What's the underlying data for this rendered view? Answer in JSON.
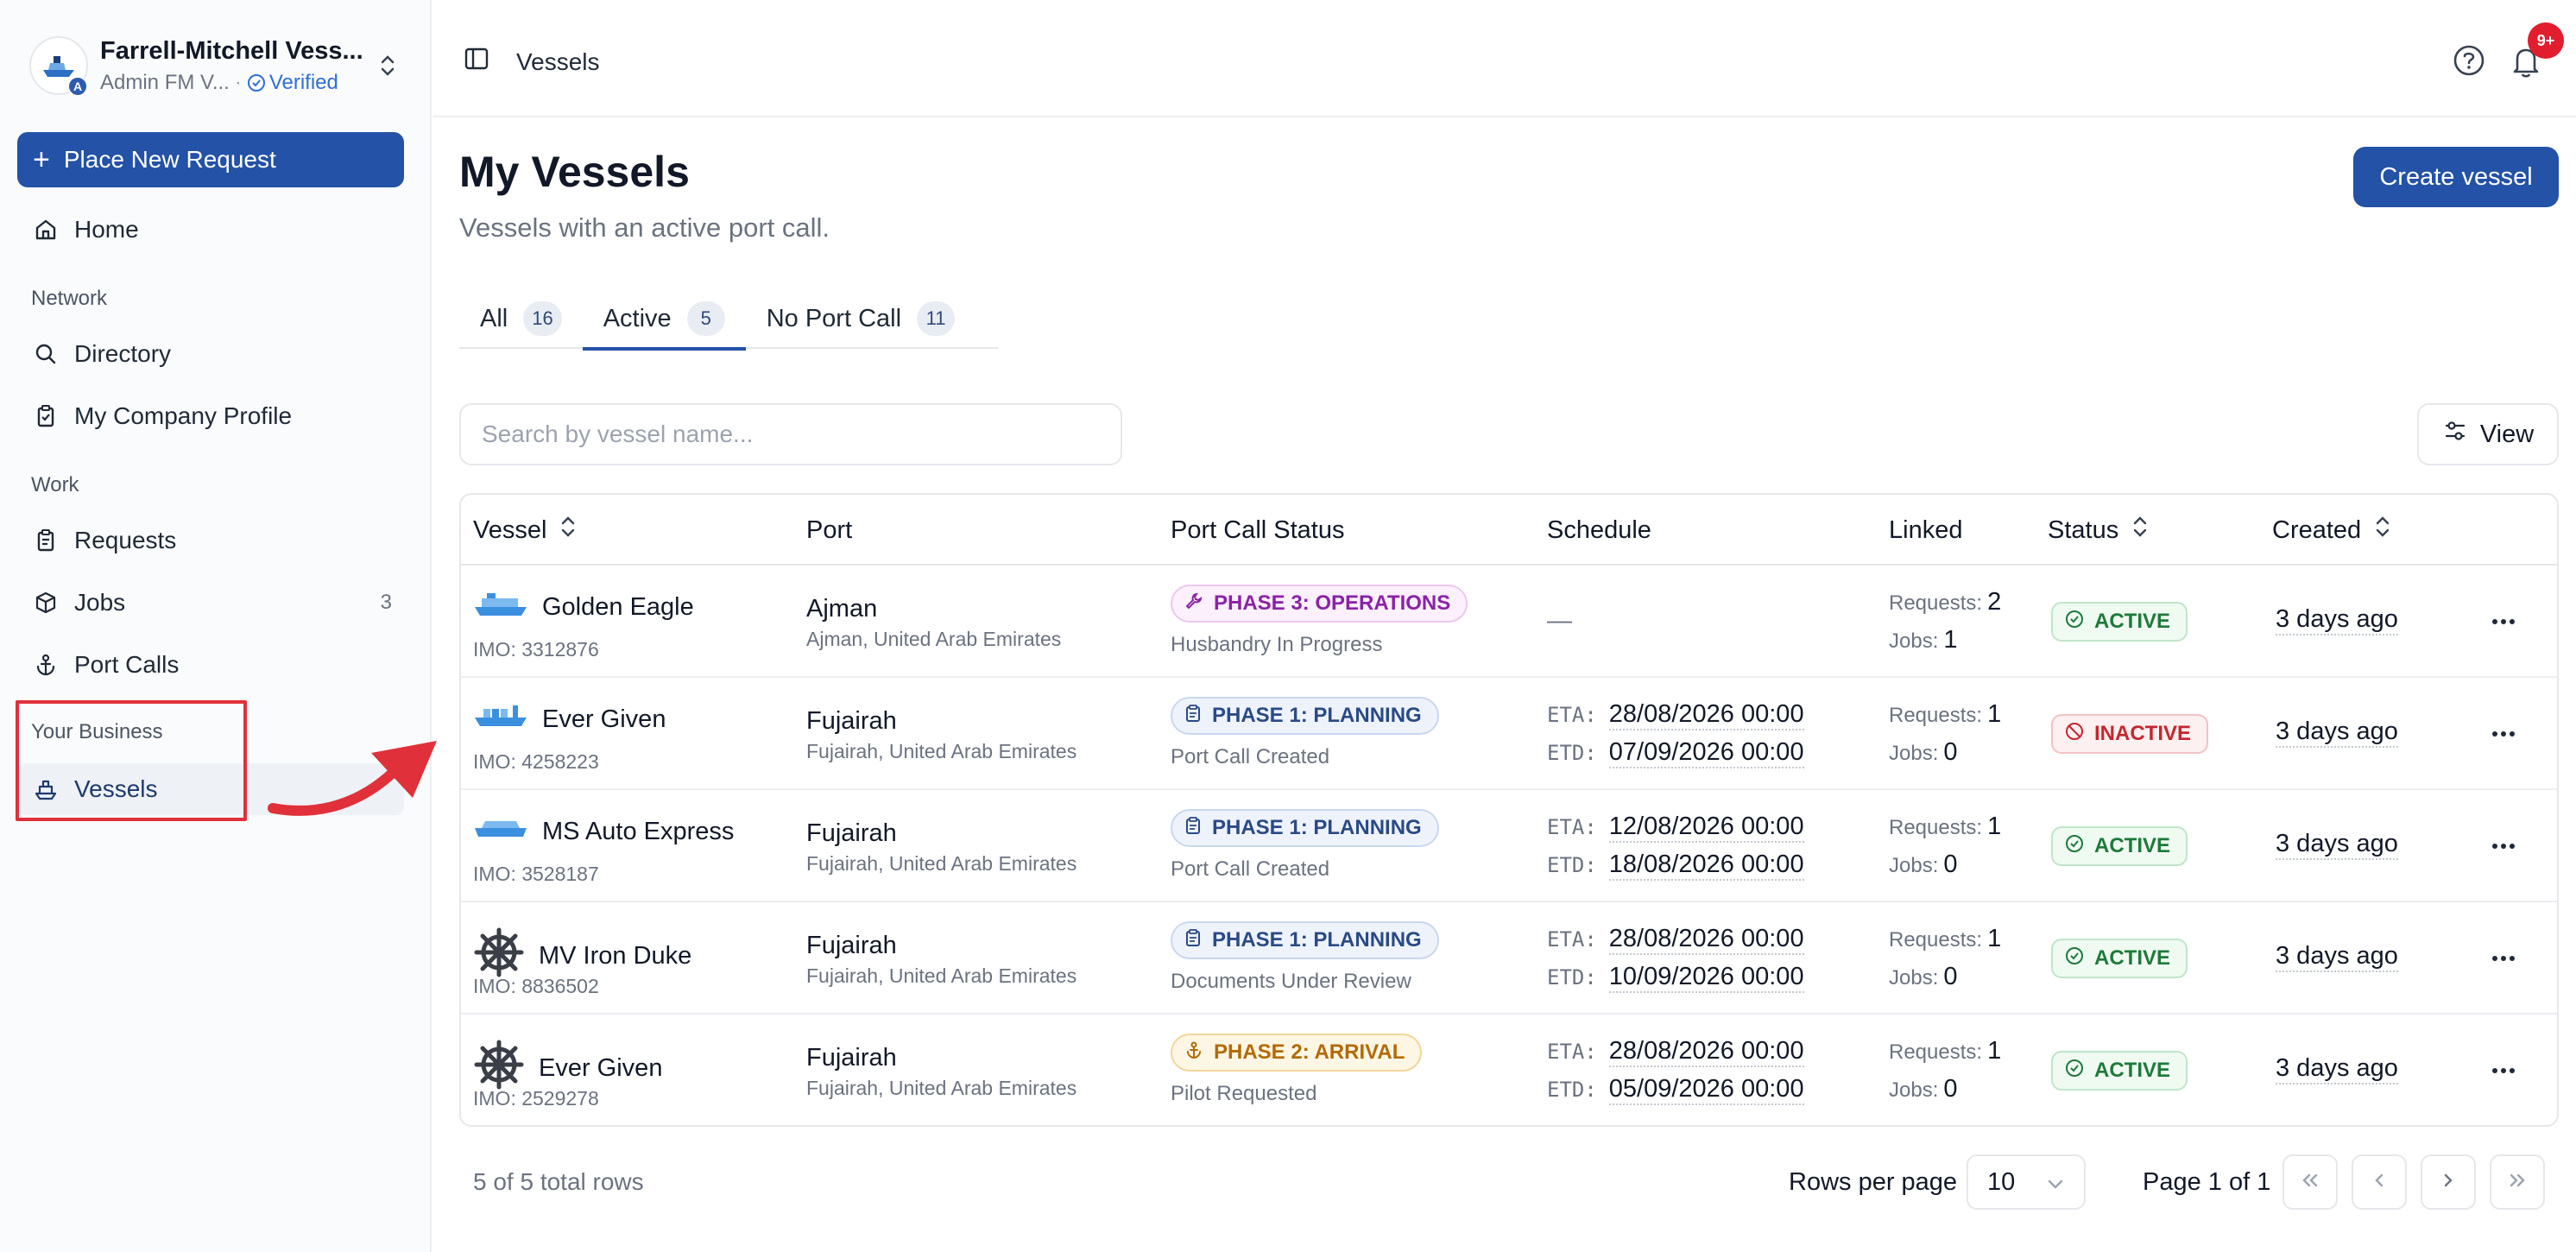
{
  "org": {
    "name": "Farrell-Mitchell Vess...",
    "role": "Admin FM V...",
    "verified_label": "Verified",
    "avatar_letter": "A"
  },
  "sidebar": {
    "place_request_label": "Place New Request",
    "home_label": "Home",
    "network_section": "Network",
    "directory_label": "Directory",
    "company_profile_label": "My Company Profile",
    "work_section": "Work",
    "requests_label": "Requests",
    "jobs_label": "Jobs",
    "jobs_count": "3",
    "port_calls_label": "Port Calls",
    "business_section": "Your Business",
    "vessels_label": "Vessels"
  },
  "topbar": {
    "breadcrumb": "Vessels",
    "notification_badge": "9+"
  },
  "page": {
    "title": "My Vessels",
    "subtitle": "Vessels with an active port call.",
    "create_label": "Create vessel",
    "search_placeholder": "Search by vessel name...",
    "view_label": "View"
  },
  "tabs": [
    {
      "label": "All",
      "count": "16"
    },
    {
      "label": "Active",
      "count": "5"
    },
    {
      "label": "No Port Call",
      "count": "11"
    }
  ],
  "table": {
    "headers": {
      "vessel": "Vessel",
      "port": "Port",
      "port_call_status": "Port Call Status",
      "schedule": "Schedule",
      "linked": "Linked",
      "status": "Status",
      "created": "Created"
    },
    "eta_label": "ETA:",
    "etd_label": "ETD:",
    "requests_label": "Requests:",
    "jobs_label": "Jobs:",
    "rows": [
      {
        "name": "Golden Eagle",
        "imo": "IMO: 3312876",
        "port": "Ajman",
        "country": "Ajman, United Arab Emirates",
        "phase": "PHASE 3: OPERATIONS",
        "phase_sub": "Husbandry In Progress",
        "schedule_empty": "—",
        "requests": "2",
        "jobs": "1",
        "status": "ACTIVE",
        "created": "3 days ago"
      },
      {
        "name": "Ever Given",
        "imo": "IMO: 4258223",
        "port": "Fujairah",
        "country": "Fujairah, United Arab Emirates",
        "phase": "PHASE 1: PLANNING",
        "phase_sub": "Port Call Created",
        "eta": "28/08/2026 00:00",
        "etd": "07/09/2026 00:00",
        "requests": "1",
        "jobs": "0",
        "status": "INACTIVE",
        "created": "3 days ago"
      },
      {
        "name": "MS Auto Express",
        "imo": "IMO: 3528187",
        "port": "Fujairah",
        "country": "Fujairah, United Arab Emirates",
        "phase": "PHASE 1: PLANNING",
        "phase_sub": "Port Call Created",
        "eta": "12/08/2026 00:00",
        "etd": "18/08/2026 00:00",
        "requests": "1",
        "jobs": "0",
        "status": "ACTIVE",
        "created": "3 days ago"
      },
      {
        "name": "MV Iron Duke",
        "imo": "IMO: 8836502",
        "port": "Fujairah",
        "country": "Fujairah, United Arab Emirates",
        "phase": "PHASE 1: PLANNING",
        "phase_sub": "Documents Under Review",
        "eta": "28/08/2026 00:00",
        "etd": "10/09/2026 00:00",
        "requests": "1",
        "jobs": "0",
        "status": "ACTIVE",
        "created": "3 days ago"
      },
      {
        "name": "Ever Given",
        "imo": "IMO: 2529278",
        "port": "Fujairah",
        "country": "Fujairah, United Arab Emirates",
        "phase": "PHASE 2: ARRIVAL",
        "phase_sub": "Pilot Requested",
        "eta": "28/08/2026 00:00",
        "etd": "05/09/2026 00:00",
        "requests": "1",
        "jobs": "0",
        "status": "ACTIVE",
        "created": "3 days ago"
      }
    ]
  },
  "footer": {
    "total_rows": "5 of 5 total rows",
    "rows_per_page_label": "Rows per page",
    "rows_per_page_value": "10",
    "page_info": "Page 1 of 1"
  },
  "colors": {
    "primary": "#2352a6",
    "highlight": "#e0303a",
    "active_green": "#1e7a3a",
    "inactive_red": "#c3272f"
  }
}
